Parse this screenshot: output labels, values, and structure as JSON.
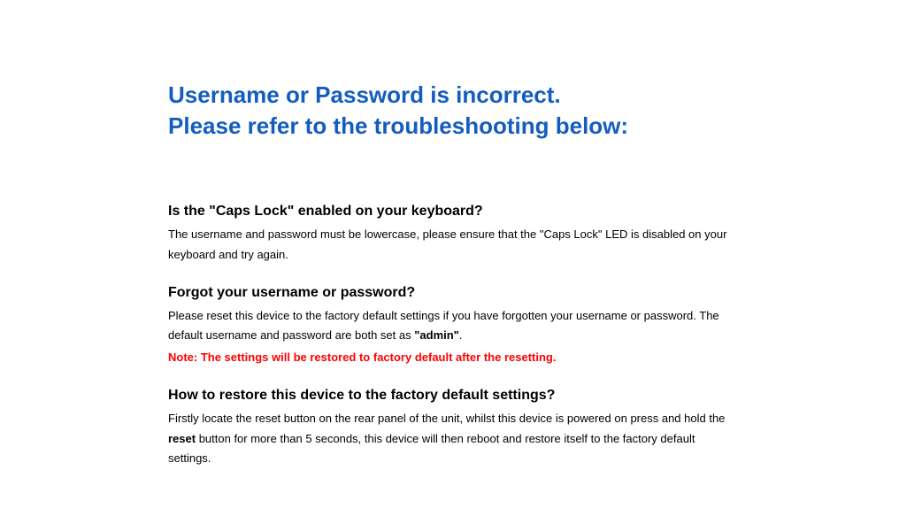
{
  "title_line1": "Username or Password is incorrect.",
  "title_line2": "Please refer to the troubleshooting below:",
  "sections": {
    "capslock": {
      "heading": "Is the \"Caps Lock\" enabled on your keyboard?",
      "body": "The username and password must be lowercase, please ensure that the \"Caps Lock\" LED is disabled on your keyboard and try again."
    },
    "forgot": {
      "heading": "Forgot your username or password?",
      "body_part1": "Please reset this device to the factory default settings if you have forgotten your username or password. The default username and password are both set as ",
      "body_bold": "\"admin\"",
      "body_part2": ".",
      "note": "Note: The settings will be restored to factory default after the resetting."
    },
    "restore": {
      "heading": "How to restore this device to the factory default settings?",
      "body_part1": "Firstly locate the reset button on the rear panel of the unit, whilst this device is powered on press and hold the ",
      "body_bold": "reset",
      "body_part2": " button for more than 5 seconds, this device will then reboot and restore itself to the factory default settings."
    }
  }
}
